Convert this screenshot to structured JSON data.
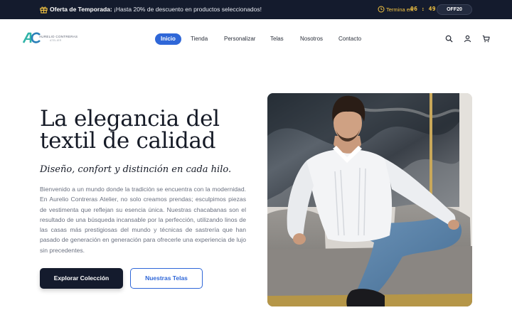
{
  "promo": {
    "label": "Oferta de Temporada:",
    "message": "¡Hasta 20% de descuento en productos seleccionados!",
    "ends_label": "Termina en:",
    "countdown": "06 : 49 : 53",
    "coupon_code": "OFF20",
    "accent_color": "#f5c542"
  },
  "header": {
    "brand_name": "AURELIO CONTRERAS",
    "brand_sub": "ATELIER",
    "nav": [
      {
        "label": "Inicio",
        "active": true
      },
      {
        "label": "Tienda",
        "active": false
      },
      {
        "label": "Personalizar",
        "active": false
      },
      {
        "label": "Telas",
        "active": false
      },
      {
        "label": "Nosotros",
        "active": false
      },
      {
        "label": "Contacto",
        "active": false
      }
    ],
    "icons": [
      "search-icon",
      "user-icon",
      "cart-icon"
    ]
  },
  "hero": {
    "title": "La elegancia del textil de calidad",
    "subtitle": "Diseño, confort y distinción en cada hilo.",
    "body": "Bienvenido a un mundo donde la tradición se encuentra con la modernidad. En Aurelio Contreras Atelier, no solo creamos prendas; esculpimos piezas de vestimenta que reflejan su esencia única. Nuestras chacabanas son el resultado de una búsqueda incansable por la perfección, utilizando linos de las casas más prestigiosas del mundo y técnicas de sastrería que han pasado de generación en generación para ofrecerle una experiencia de lujo sin precedentes.",
    "primary_button": "Explorar Colección",
    "secondary_button": "Nuestras Telas"
  },
  "colors": {
    "dark": "#141b2d",
    "brand_blue": "#2f67d8",
    "logo_teal": "#2fb3a7"
  }
}
